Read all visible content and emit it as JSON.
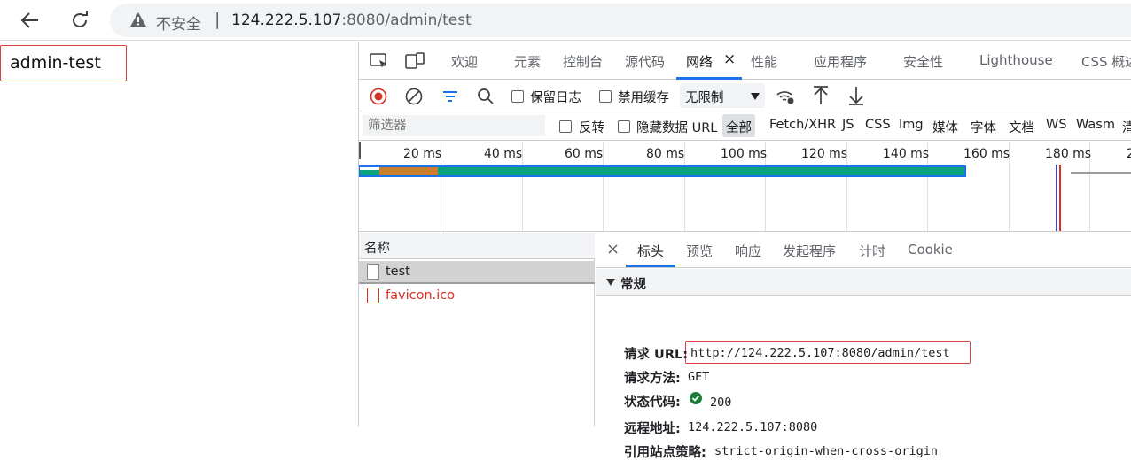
{
  "browser": {
    "insecure_label": "不安全",
    "separator": "|",
    "url_host": "124.222.5.107",
    "url_rest": ":8080/admin/test"
  },
  "page": {
    "heading": "admin-test"
  },
  "devtools": {
    "tabs": [
      "欢迎",
      "元素",
      "控制台",
      "源代码",
      "网络",
      "性能",
      "应用程序",
      "安全性",
      "Lighthouse",
      "CSS 概述"
    ],
    "active_tab": "网络",
    "tab_close": "×",
    "toolbar": {
      "preserve_log": "保留日志",
      "disable_cache": "禁用缓存",
      "throttle": "无限制"
    },
    "filter": {
      "placeholder": "筛选器",
      "invert": "反转",
      "hide_data_url": "隐藏数据 URL",
      "types": [
        "全部",
        "Fetch/XHR",
        "JS",
        "CSS",
        "Img",
        "媒体",
        "字体",
        "文档",
        "WS",
        "Wasm",
        "清"
      ]
    },
    "timeline": {
      "ticks": [
        "20 ms",
        "40 ms",
        "60 ms",
        "80 ms",
        "100 ms",
        "120 ms",
        "140 ms",
        "160 ms",
        "180 ms",
        "2"
      ]
    },
    "requests": {
      "header": "名称",
      "items": [
        {
          "name": "test",
          "status": "selected"
        },
        {
          "name": "favicon.ico",
          "status": "error"
        }
      ]
    },
    "detail": {
      "close": "×",
      "tabs": [
        "标头",
        "预览",
        "响应",
        "发起程序",
        "计时",
        "Cookie"
      ],
      "section": "常规",
      "rows": [
        {
          "key": "请求 URL:",
          "value": "http://124.222.5.107:8080/admin/test"
        },
        {
          "key": "请求方法:",
          "value": "GET"
        },
        {
          "key": "状态代码:",
          "value": "200"
        },
        {
          "key": "远程地址:",
          "value": "124.222.5.107:8080"
        },
        {
          "key": "引用站点策略:",
          "value": "strict-origin-when-cross-origin"
        }
      ]
    }
  },
  "colors": {
    "accent": "#1a73e8",
    "error": "#d93025",
    "highlight": "#e04040",
    "record": "#d93025",
    "status_ok": "#188038"
  }
}
